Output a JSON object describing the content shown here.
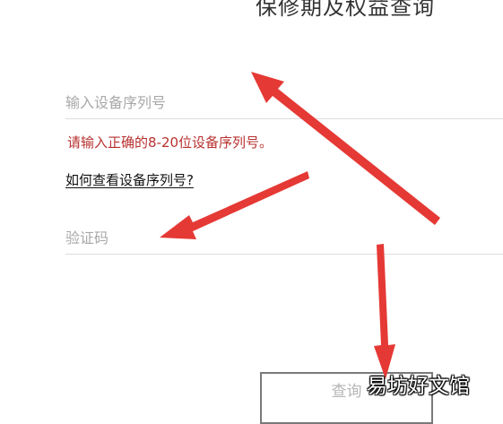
{
  "page": {
    "title": "保修期及权益查询"
  },
  "form": {
    "serial_placeholder": "输入设备序列号",
    "serial_value": "",
    "serial_error": "请输入正确的8-20位设备序列号。",
    "help_link": "如何查看设备序列号?",
    "captcha_placeholder": "验证码",
    "captcha_value": "",
    "query_button": "查询"
  },
  "overlay": {
    "watermark": "易坊好文馆",
    "annotation_color": "#e53935"
  }
}
